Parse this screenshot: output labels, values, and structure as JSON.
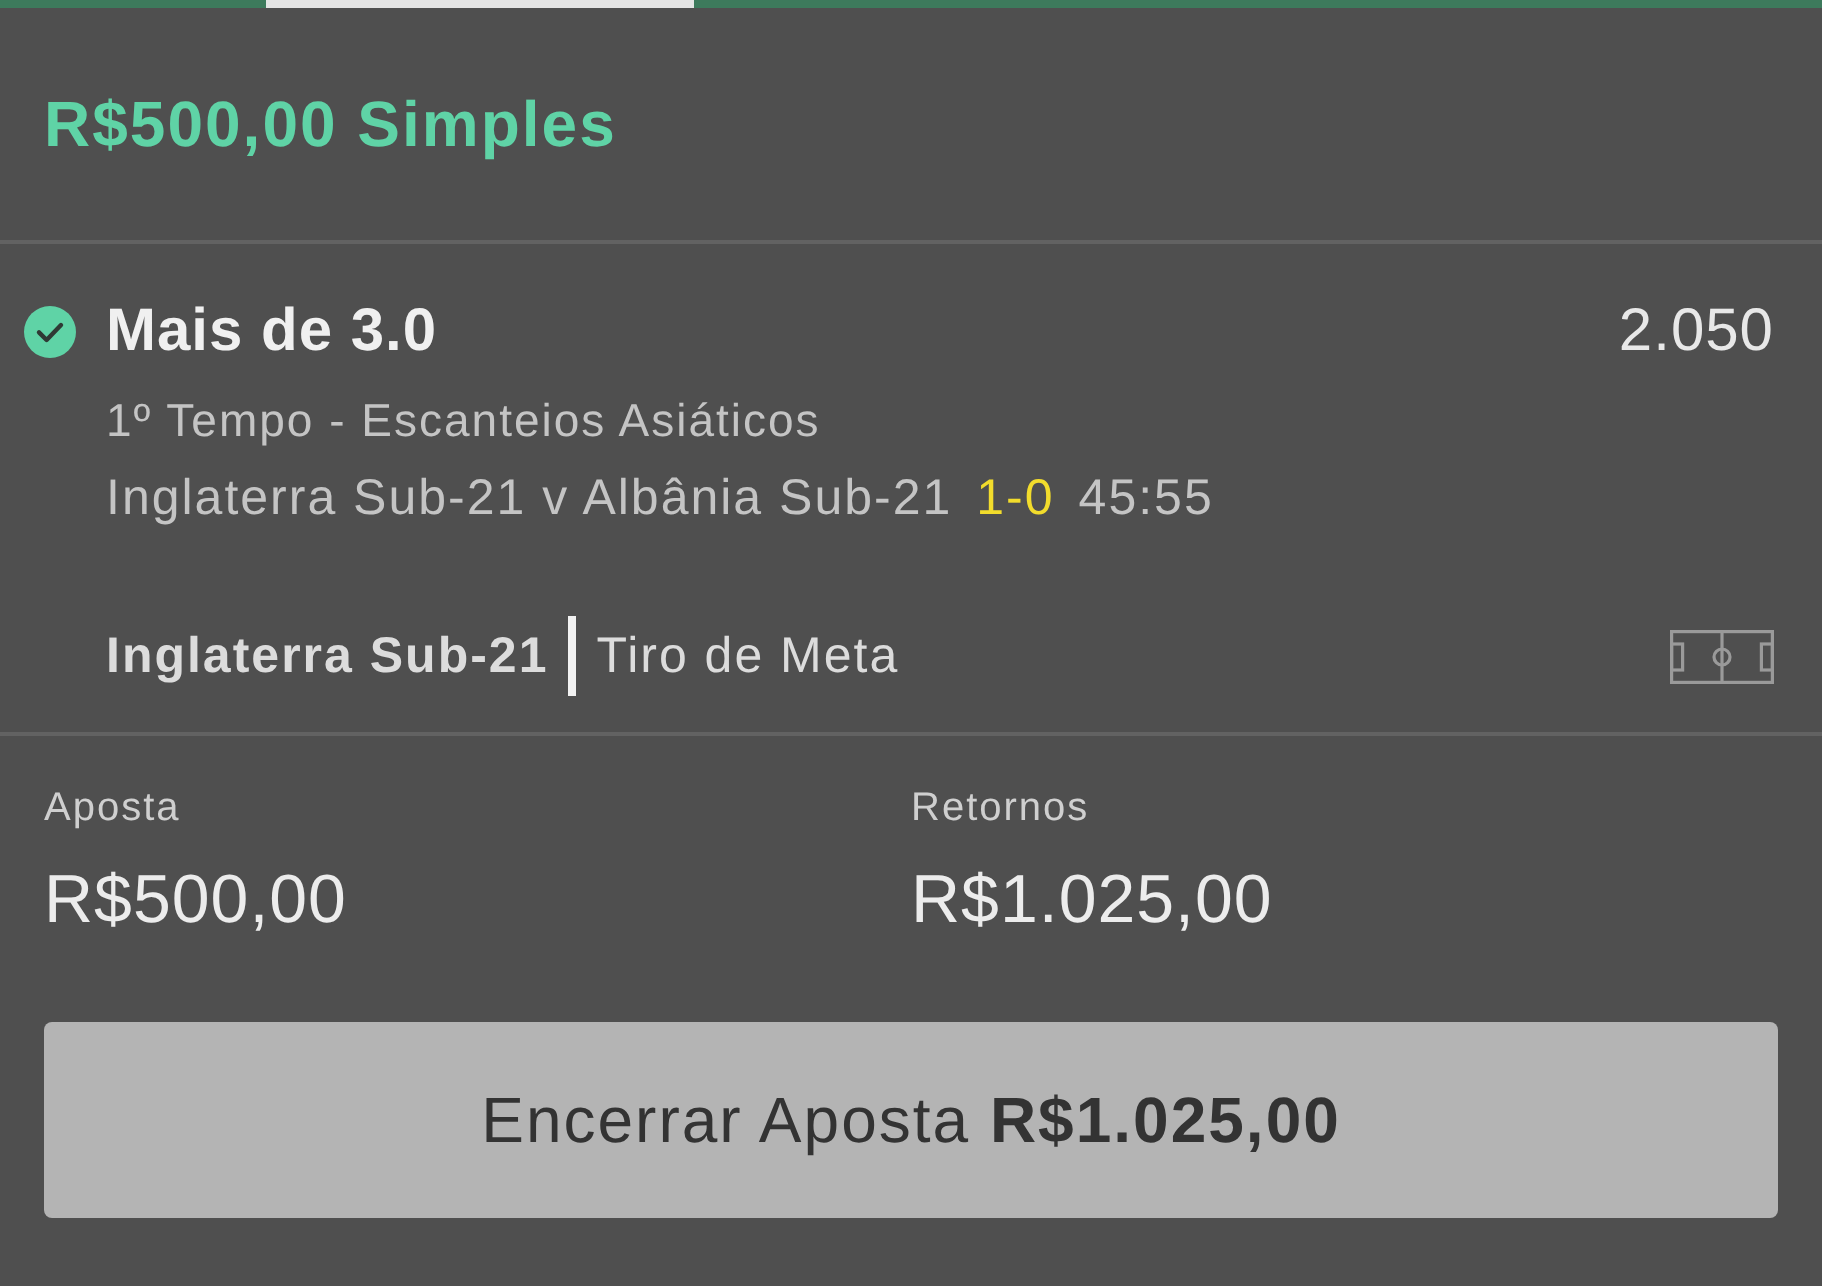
{
  "bet_header": {
    "title": "R$500,00 Simples"
  },
  "selection": {
    "name": "Mais de 3.0",
    "odds": "2.050",
    "market": "1º Tempo - Escanteios Asiáticos",
    "event": "Inglaterra Sub-21 v Albânia Sub-21",
    "score": "1-0",
    "clock": "45:55"
  },
  "live_event": {
    "team": "Inglaterra Sub-21",
    "action": "Tiro de Meta"
  },
  "summary": [
    {
      "label": "Aposta",
      "value": "R$500,00"
    },
    {
      "label": "Retornos",
      "value": "R$1.025,00"
    }
  ],
  "cash_out_button": {
    "label": "Encerrar Aposta **R$1.025,00**"
  }
}
